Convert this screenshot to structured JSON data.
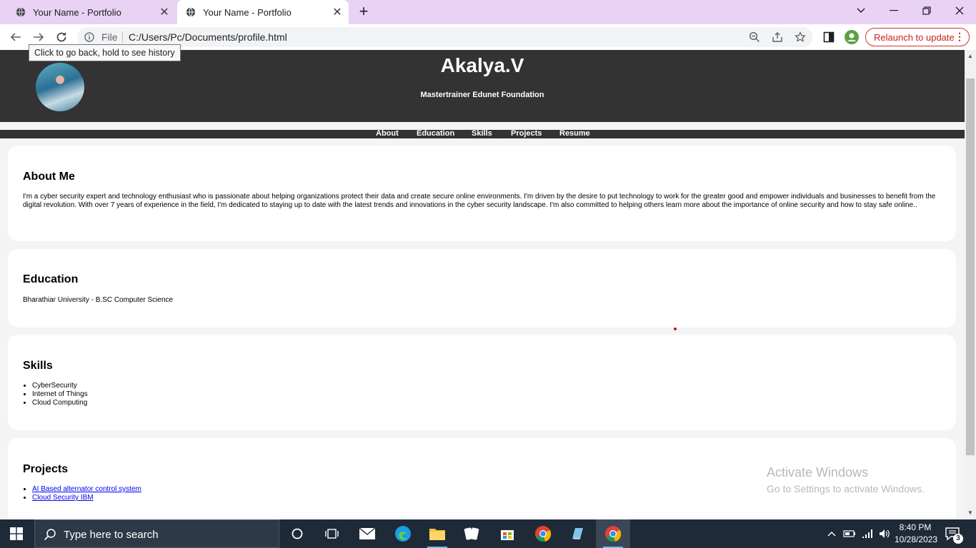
{
  "browser": {
    "tabs": [
      {
        "title": "Your Name - Portfolio"
      },
      {
        "title": "Your Name - Portfolio"
      }
    ],
    "address": {
      "scheme_label": "File",
      "url": "C:/Users/Pc/Documents/profile.html"
    },
    "relaunch_label": "Relaunch to update",
    "tooltip": "Click to go back, hold to see history"
  },
  "site": {
    "name": "Akalya.V",
    "subtitle": "Mastertrainer Edunet Foundation",
    "nav": [
      {
        "label": "About"
      },
      {
        "label": "Education"
      },
      {
        "label": "Skills"
      },
      {
        "label": "Projects"
      },
      {
        "label": "Resume"
      }
    ],
    "about": {
      "heading": "About Me",
      "text": "I'm a cyber security expert and technology enthusiast who is passionate about helping organizations protect their data and create secure online environments. I'm driven by the desire to put technology to work for the greater good and empower individuals and businesses to benefit from the digital revolution. With over 7 years of experience in the field, I'm dedicated to staying up to date with the latest trends and innovations in the cyber security landscape. I'm also committed to helping others learn more about the importance of online security and how to stay safe online.."
    },
    "education": {
      "heading": "Education",
      "text": "Bharathiar University - B.SC Computer Science"
    },
    "skills": {
      "heading": "Skills",
      "items": [
        "CyberSecurity",
        "Internet of Things",
        "Cloud Computing"
      ]
    },
    "projects": {
      "heading": "Projects",
      "items": [
        "AI Based alternator control system",
        "Cloud Security IBM"
      ]
    }
  },
  "watermark": {
    "line1": "Activate Windows",
    "line2": "Go to Settings to activate Windows."
  },
  "taskbar": {
    "search_placeholder": "Type here to search",
    "time": "8:40 PM",
    "date": "10/28/2023",
    "notification_count": "3"
  },
  "colors": {
    "tabstrip": "#e9d2f4",
    "header": "#333333",
    "relaunch": "#d93025",
    "taskbar": "#1f2a38"
  }
}
